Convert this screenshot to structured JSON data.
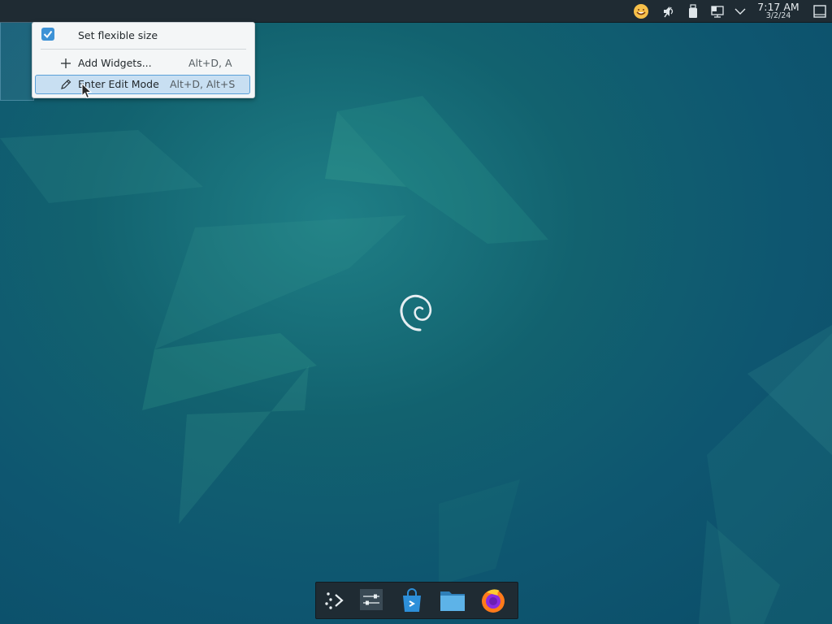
{
  "panel": {
    "clock_time": "7:17 AM",
    "clock_date": "3/2/24",
    "tray_icons": [
      "emoji-icon",
      "speaker-muted-icon",
      "usb-drive-icon",
      "network-icon",
      "chevron-down-icon",
      "show-desktop-icon"
    ]
  },
  "context_menu": {
    "items": [
      {
        "label": "Set flexible size",
        "checked": true,
        "icon": "checkbox-icon",
        "shortcut": ""
      },
      {
        "label": "Add Widgets...",
        "icon": "plus-icon",
        "shortcut": "Alt+D, A"
      },
      {
        "label": "Enter Edit Mode",
        "icon": "pencil-icon",
        "shortcut": "Alt+D, Alt+S",
        "highlighted": true
      }
    ]
  },
  "dock": {
    "items": [
      "app-launcher-icon",
      "system-settings-icon",
      "discover-store-icon",
      "file-manager-icon",
      "firefox-icon"
    ]
  },
  "colors": {
    "panel_bg": "#1f2b33",
    "menu_bg": "#f4f6f7",
    "highlight_bg": "#c8dff2",
    "highlight_border": "#5aa0d8",
    "accent": "#3d92d6"
  }
}
